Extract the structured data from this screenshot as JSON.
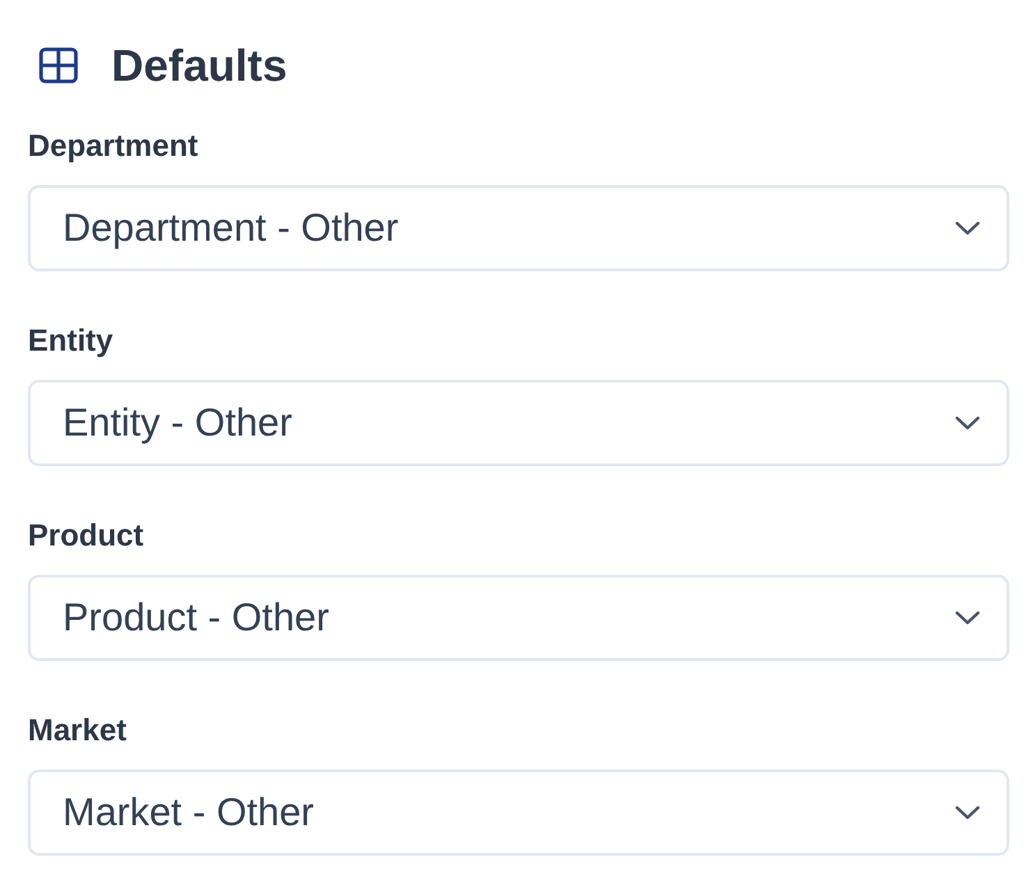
{
  "header": {
    "title": "Defaults"
  },
  "fields": [
    {
      "label": "Department",
      "value": "Department - Other"
    },
    {
      "label": "Entity",
      "value": "Entity - Other"
    },
    {
      "label": "Product",
      "value": "Product - Other"
    },
    {
      "label": "Market",
      "value": "Market - Other"
    }
  ]
}
